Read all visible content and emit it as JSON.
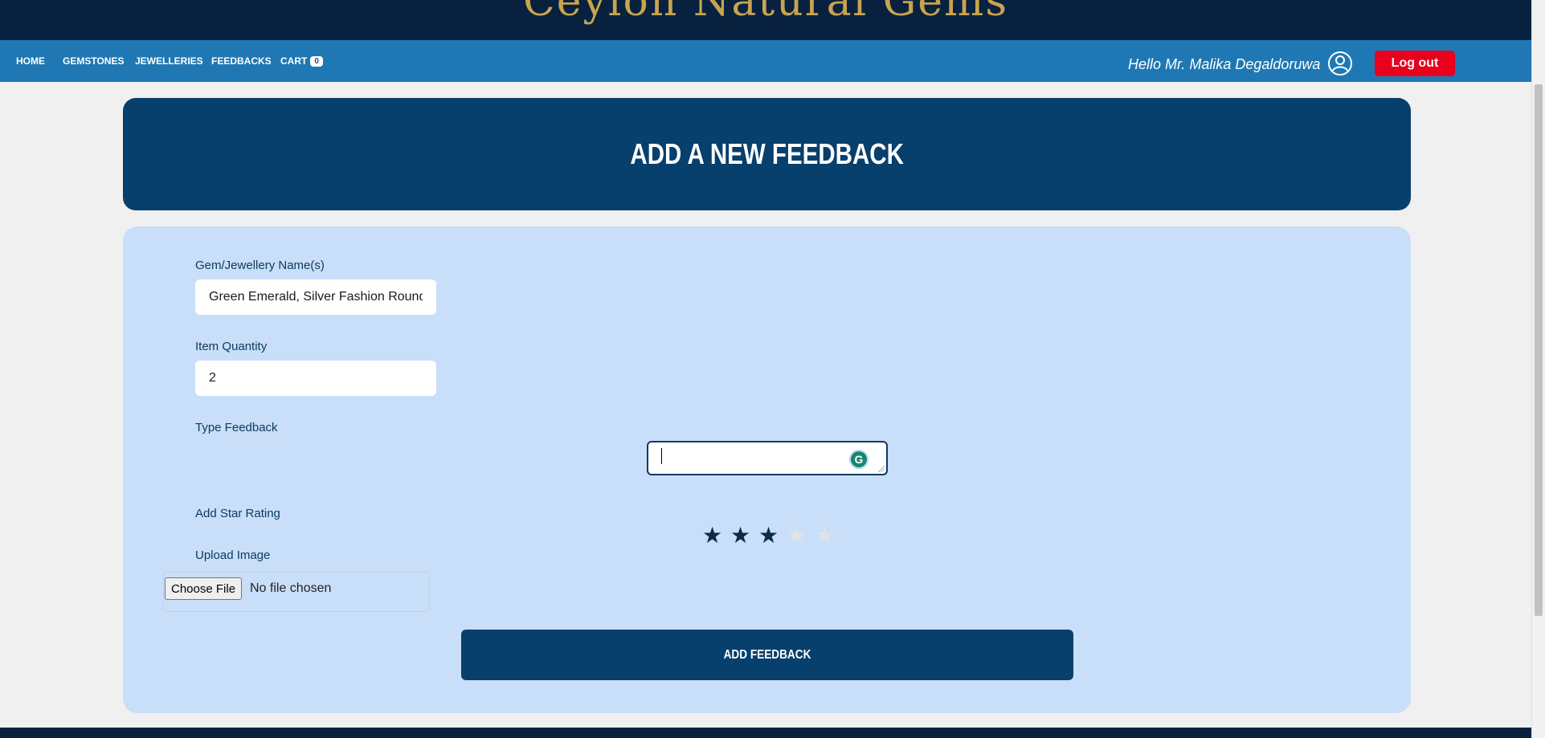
{
  "brand": {
    "name": "Ceylon Natural Gems"
  },
  "nav": {
    "items": [
      {
        "label": "HOME"
      },
      {
        "label": "GEMSTONES"
      },
      {
        "label": "JEWELLERIES"
      },
      {
        "label": "FEEDBACKS"
      },
      {
        "label": "CART"
      }
    ],
    "cart_count": "0",
    "greeting": "Hello Mr. Malika Degaldoruwa",
    "logout_label": "Log out"
  },
  "page": {
    "title": "ADD A NEW FEEDBACK"
  },
  "form": {
    "name_label": "Gem/Jewellery Name(s)",
    "name_value": "Green Emerald, Silver Fashion Round",
    "quantity_label": "Item Quantity",
    "quantity_value": "2",
    "feedback_label": "Type Feedback",
    "feedback_value": "",
    "rating_label": "Add Star Rating",
    "rating": 3,
    "rating_max": 5,
    "upload_label": "Upload Image",
    "choose_file_label": "Choose File",
    "file_status": "No file chosen",
    "submit_label": "ADD FEEDBACK"
  },
  "colors": {
    "nav_bg": "#1f78b3",
    "header_bg": "#073f6d",
    "form_bg": "#c9def8",
    "logout_bg": "#e8001c",
    "brand_gold": "#c8a44f"
  }
}
